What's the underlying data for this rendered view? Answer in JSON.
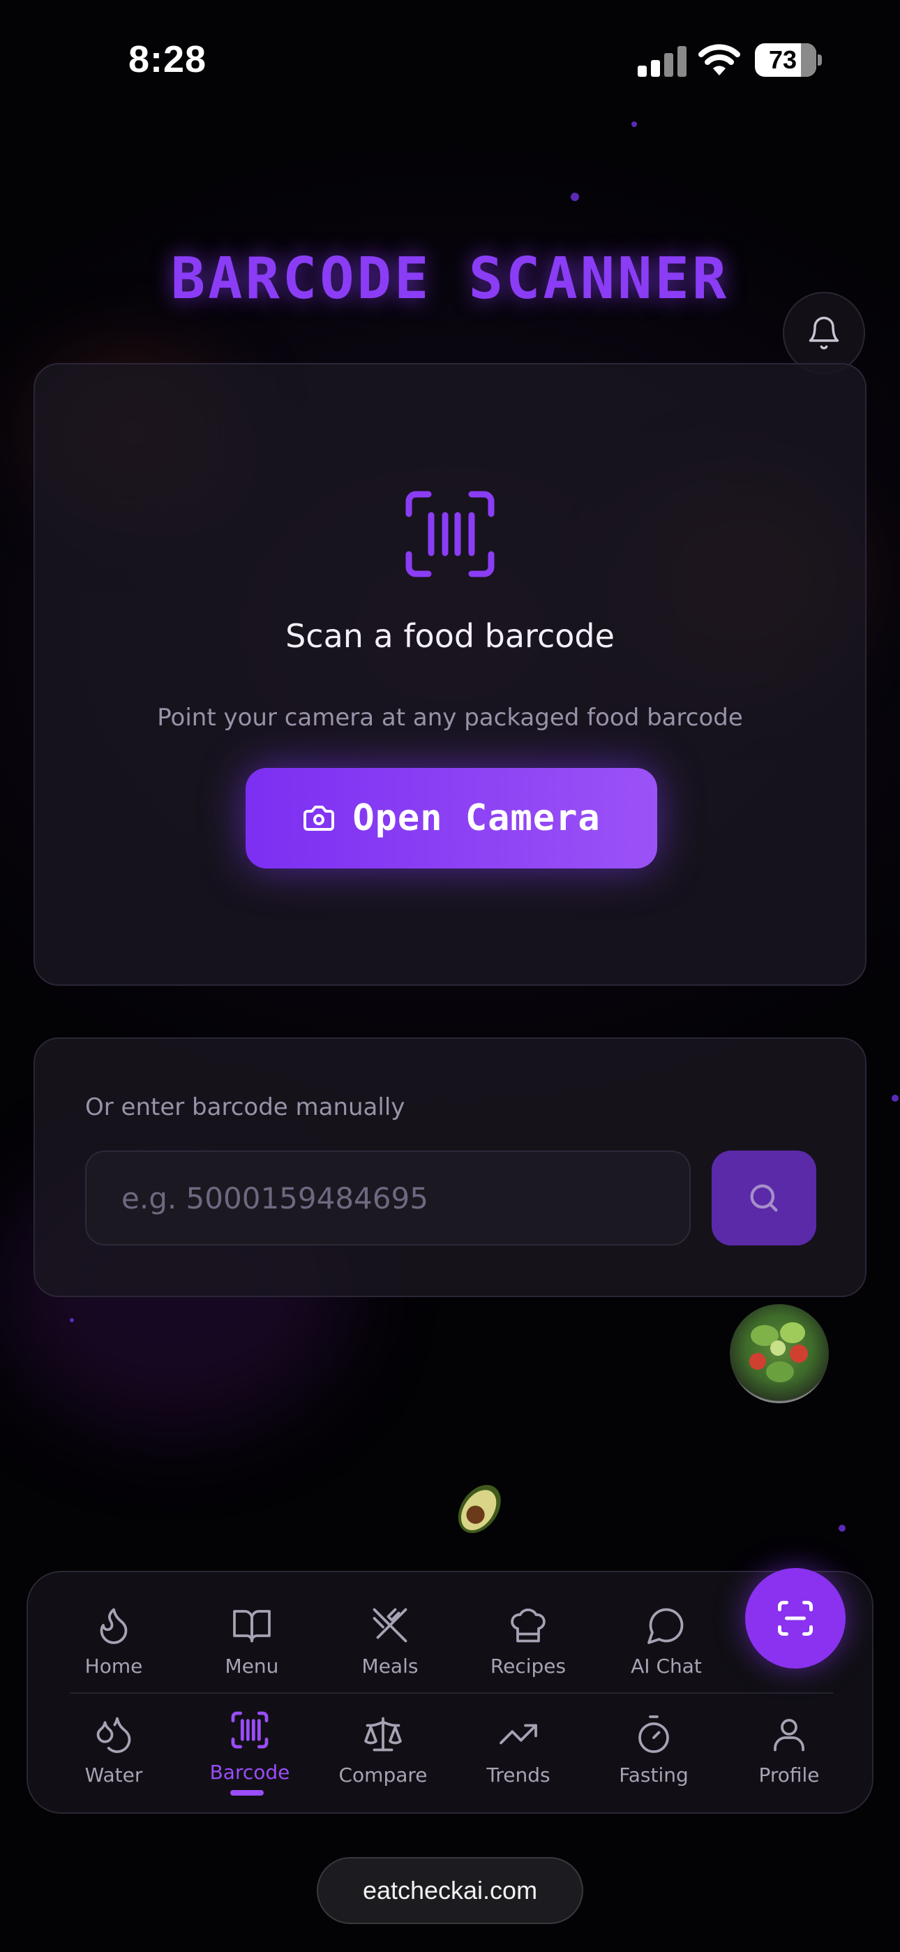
{
  "status_bar": {
    "time": "8:28",
    "battery": "73"
  },
  "header": {
    "title": "BARCODE SCANNER"
  },
  "scan_card": {
    "heading": "Scan a food barcode",
    "subtitle": "Point your camera at any packaged food barcode",
    "button_label": "Open Camera"
  },
  "manual_card": {
    "label": "Or enter barcode manually",
    "input_value": "",
    "input_placeholder": "e.g. 5000159484695"
  },
  "nav": {
    "row1": [
      {
        "label": "Home",
        "icon": "flame-icon"
      },
      {
        "label": "Menu",
        "icon": "book-icon"
      },
      {
        "label": "Meals",
        "icon": "utensils-icon"
      },
      {
        "label": "Recipes",
        "icon": "chef-hat-icon"
      },
      {
        "label": "AI Chat",
        "icon": "chat-bubble-icon"
      }
    ],
    "row2": [
      {
        "label": "Water",
        "icon": "droplets-icon"
      },
      {
        "label": "Barcode",
        "icon": "barcode-icon"
      },
      {
        "label": "Compare",
        "icon": "scale-icon"
      },
      {
        "label": "Trends",
        "icon": "trending-up-icon"
      },
      {
        "label": "Fasting",
        "icon": "timer-icon"
      },
      {
        "label": "Profile",
        "icon": "user-icon"
      }
    ],
    "active": "Barcode"
  },
  "url_bar": {
    "url": "eatcheckai.com"
  },
  "colors": {
    "accent": "#8a32f0",
    "accent_light": "#9b52f6",
    "background": "#050308",
    "card": "#1a1620",
    "muted_text": "#9a93a8"
  }
}
